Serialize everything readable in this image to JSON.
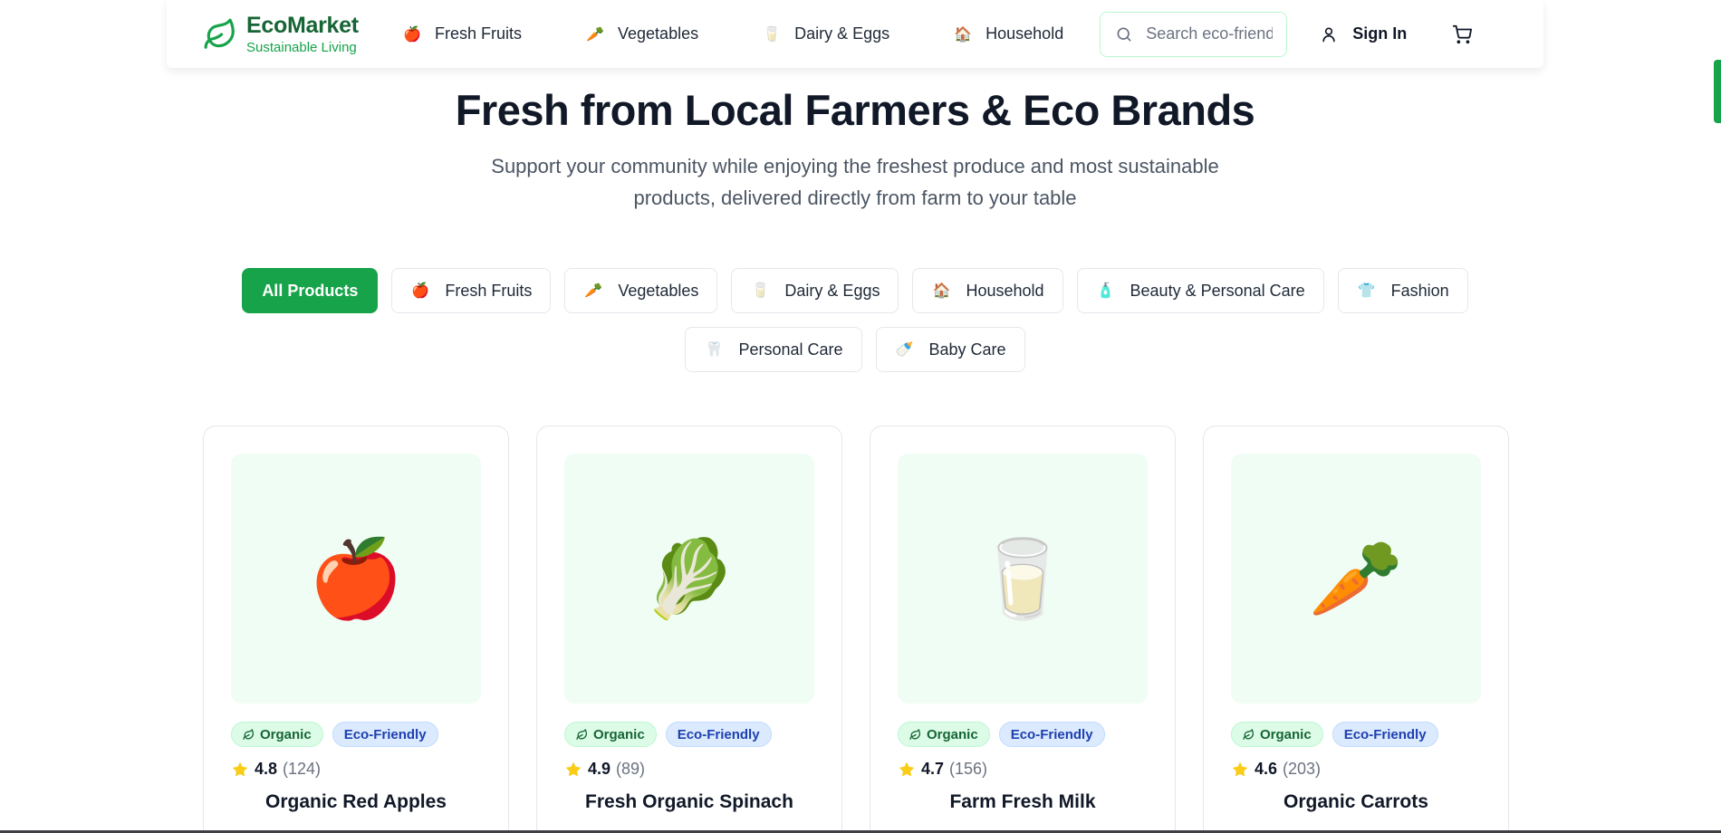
{
  "header": {
    "brand_name": "EcoMarket",
    "brand_tagline": "Sustainable Living",
    "nav": [
      {
        "label": "Fresh Fruits",
        "icon": "apple-icon",
        "emoji": "🍎"
      },
      {
        "label": "Vegetables",
        "icon": "carrot-icon",
        "emoji": "🥕"
      },
      {
        "label": "Dairy & Eggs",
        "icon": "milk-glass-icon",
        "emoji": "🥛"
      },
      {
        "label": "Household",
        "icon": "house-icon",
        "emoji": "🏠"
      }
    ],
    "search_placeholder": "Search eco-friendly products",
    "sign_in": "Sign In"
  },
  "hero": {
    "title": "Fresh from Local Farmers & Eco Brands",
    "subtitle": "Support your community while enjoying the freshest produce and most sustainable products, delivered directly from farm to your table"
  },
  "filters": [
    {
      "label": "All Products",
      "emoji": "",
      "active": true
    },
    {
      "label": "Fresh Fruits",
      "emoji": "🍎",
      "active": false
    },
    {
      "label": "Vegetables",
      "emoji": "🥕",
      "active": false
    },
    {
      "label": "Dairy & Eggs",
      "emoji": "🥛",
      "active": false
    },
    {
      "label": "Household",
      "emoji": "🏠",
      "active": false
    },
    {
      "label": "Beauty & Personal Care",
      "emoji": "🧴",
      "active": false
    },
    {
      "label": "Fashion",
      "emoji": "👕",
      "active": false
    },
    {
      "label": "Personal Care",
      "emoji": "🦷",
      "active": false
    },
    {
      "label": "Baby Care",
      "emoji": "🍼",
      "active": false
    }
  ],
  "products": [
    {
      "name": "Organic Red Apples",
      "emoji": "🍎",
      "badges": [
        "Organic",
        "Eco-Friendly"
      ],
      "rating": "4.8",
      "reviews": "(124)"
    },
    {
      "name": "Fresh Organic Spinach",
      "emoji": "🥬",
      "badges": [
        "Organic",
        "Eco-Friendly"
      ],
      "rating": "4.9",
      "reviews": "(89)"
    },
    {
      "name": "Farm Fresh Milk",
      "emoji": "🥛",
      "badges": [
        "Organic",
        "Eco-Friendly"
      ],
      "rating": "4.7",
      "reviews": "(156)"
    },
    {
      "name": "Organic Carrots",
      "emoji": "🥕",
      "badges": [
        "Organic",
        "Eco-Friendly"
      ],
      "rating": "4.6",
      "reviews": "(203)"
    }
  ],
  "colors": {
    "brand_dark": "#166534",
    "brand": "#16a34a",
    "card_bg": "#f0fdf4",
    "star": "#facc15"
  }
}
